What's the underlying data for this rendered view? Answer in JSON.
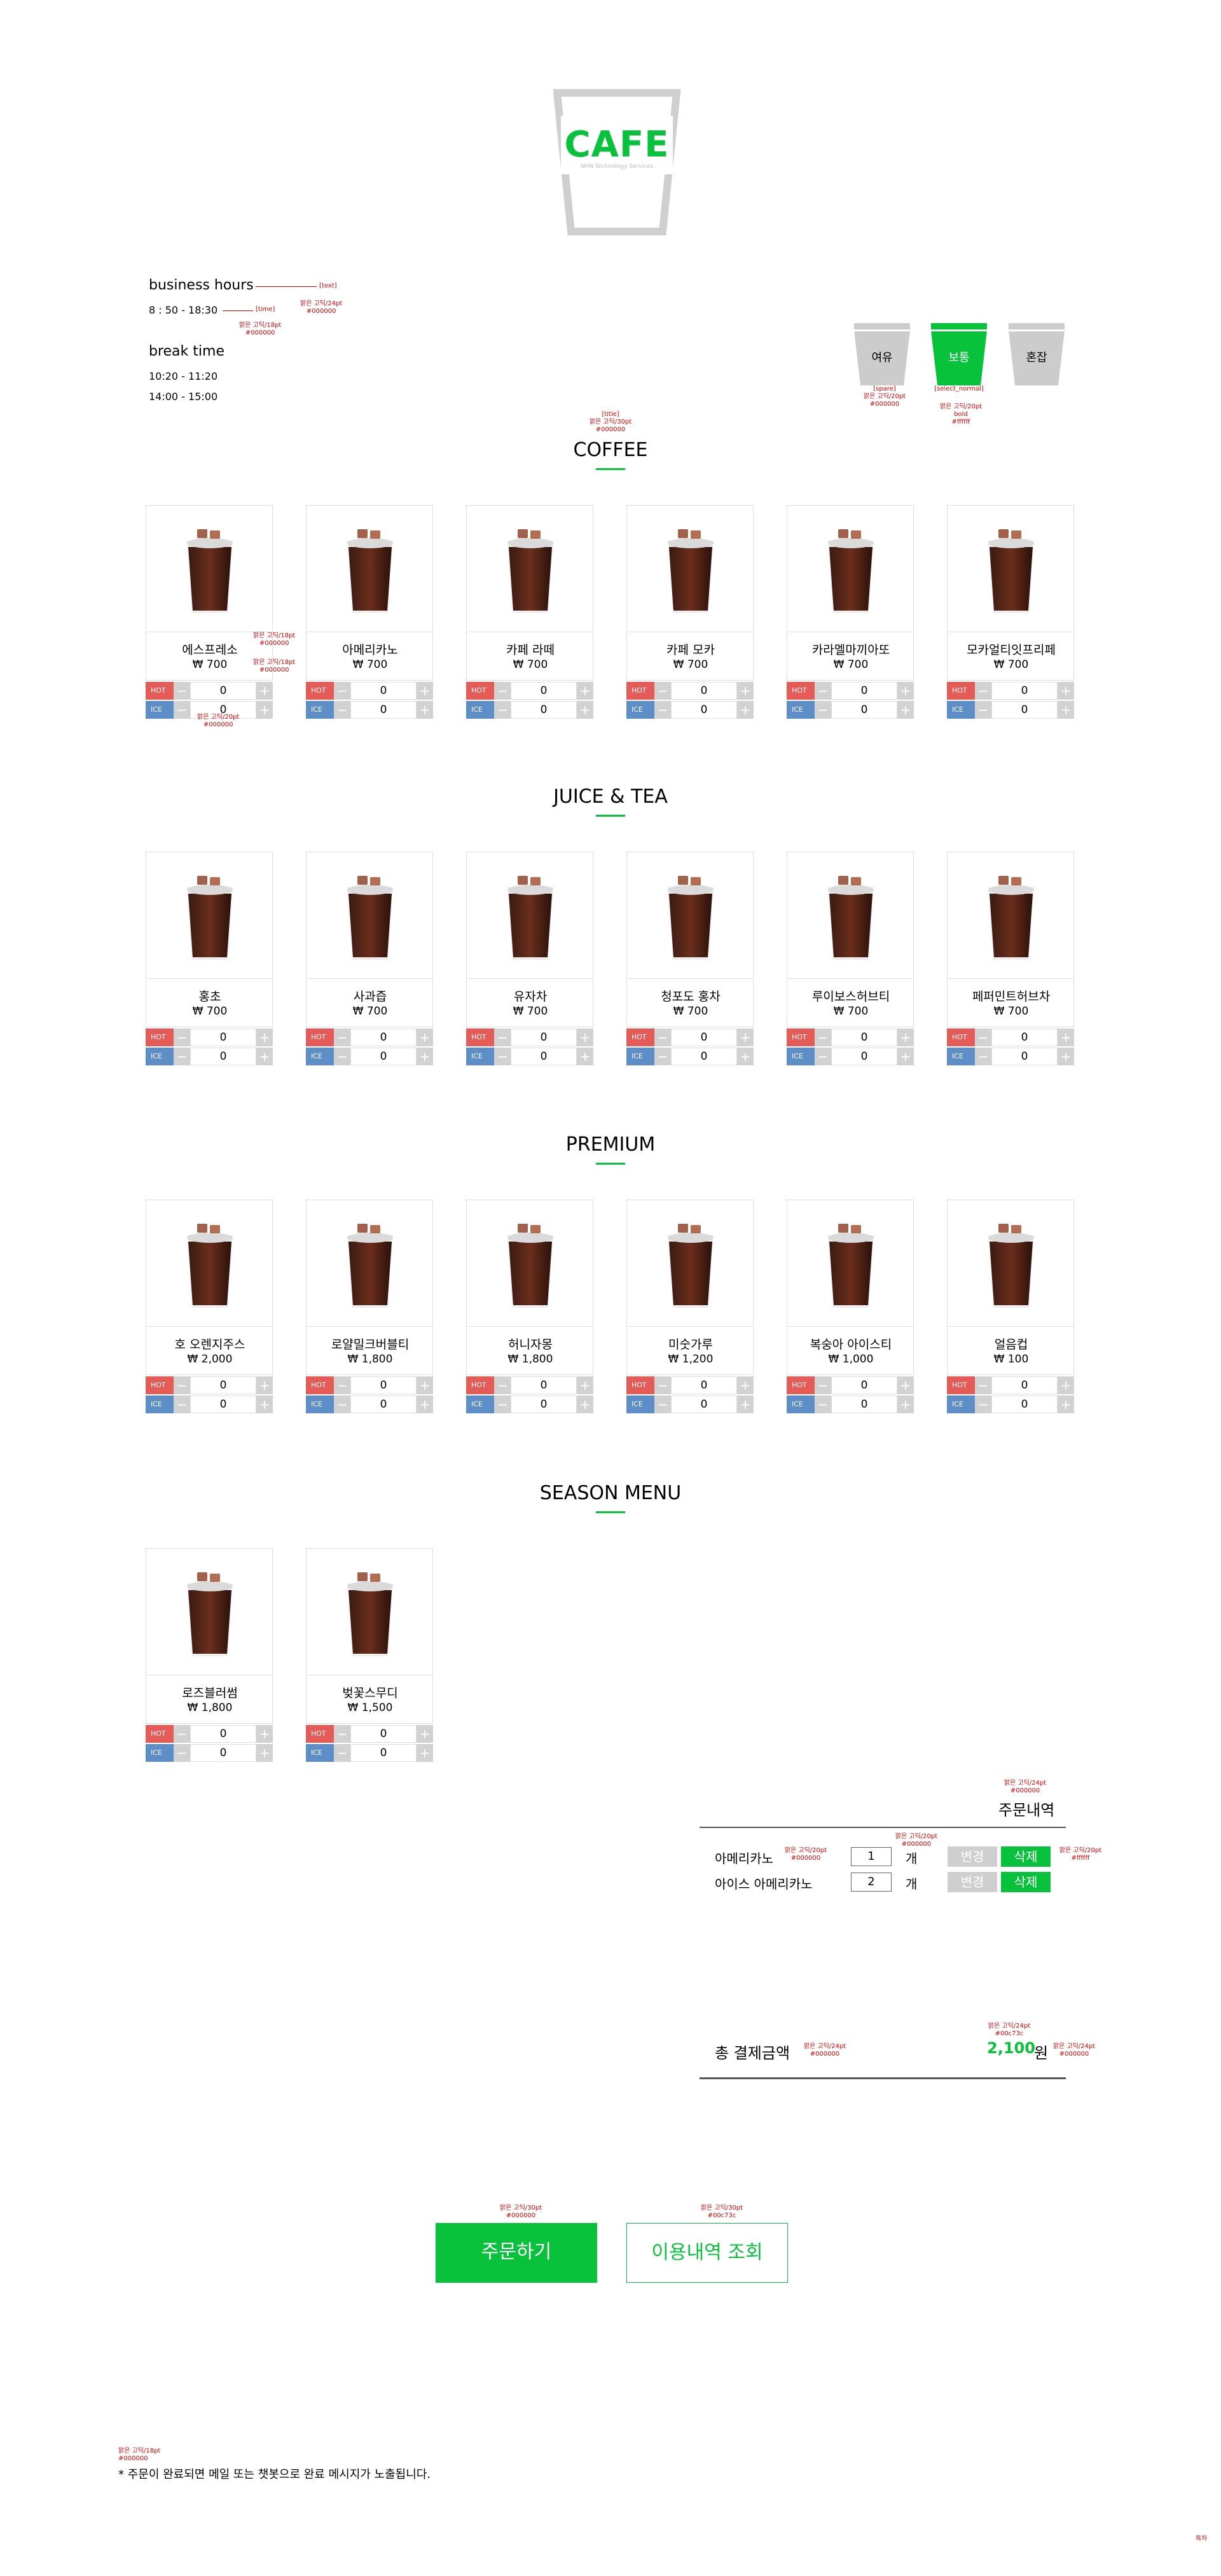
{
  "logo": {
    "title": "CAFE",
    "subtitle": "NHN Technology Services"
  },
  "hours": {
    "business_label": "business hours",
    "business_time": "8 : 50  -  18:30",
    "break_label": "break time",
    "break_times": [
      "10:20  -  11:20",
      "14:00  -  15:00"
    ]
  },
  "crowd": {
    "options": [
      {
        "label": "여유",
        "color": "#cccccc",
        "selected": false
      },
      {
        "label": "보통",
        "color": "#09c23c",
        "selected": true
      },
      {
        "label": "혼잡",
        "color": "#cccccc",
        "selected": false
      }
    ]
  },
  "sections": [
    {
      "title": "COFFEE",
      "items": [
        {
          "name": "에스프레소",
          "price": "₩ 700",
          "hot": "0",
          "ice": "0"
        },
        {
          "name": "아메리카노",
          "price": "₩ 700",
          "hot": "0",
          "ice": "0"
        },
        {
          "name": "카페 라떼",
          "price": "₩ 700",
          "hot": "0",
          "ice": "0"
        },
        {
          "name": "카페 모카",
          "price": "₩ 700",
          "hot": "0",
          "ice": "0"
        },
        {
          "name": "카라멜마끼아또",
          "price": "₩ 700",
          "hot": "0",
          "ice": "0"
        },
        {
          "name": "모카얼티잇프리페",
          "price": "₩ 700",
          "hot": "0",
          "ice": "0"
        }
      ]
    },
    {
      "title": "JUICE & TEA",
      "items": [
        {
          "name": "홍초",
          "price": "₩ 700",
          "hot": "0",
          "ice": "0"
        },
        {
          "name": "사과즙",
          "price": "₩ 700",
          "hot": "0",
          "ice": "0"
        },
        {
          "name": "유자차",
          "price": "₩ 700",
          "hot": "0",
          "ice": "0"
        },
        {
          "name": "청포도 홍차",
          "price": "₩ 700",
          "hot": "0",
          "ice": "0"
        },
        {
          "name": "루이보스허브티",
          "price": "₩ 700",
          "hot": "0",
          "ice": "0"
        },
        {
          "name": "페퍼민트허브차",
          "price": "₩ 700",
          "hot": "0",
          "ice": "0"
        }
      ]
    },
    {
      "title": "PREMIUM",
      "items": [
        {
          "name": "호 오렌지주스",
          "price": "₩ 2,000",
          "hot": "0",
          "ice": "0"
        },
        {
          "name": "로얄밀크버블티",
          "price": "₩ 1,800",
          "hot": "0",
          "ice": "0"
        },
        {
          "name": "허니자몽",
          "price": "₩ 1,800",
          "hot": "0",
          "ice": "0"
        },
        {
          "name": "미숫가루",
          "price": "₩ 1,200",
          "hot": "0",
          "ice": "0"
        },
        {
          "name": "복숭아 아이스티",
          "price": "₩ 1,000",
          "hot": "0",
          "ice": "0"
        },
        {
          "name": "얼음컵",
          "price": "₩ 100",
          "hot": "0",
          "ice": "0"
        }
      ]
    },
    {
      "title": "SEASON MENU",
      "items": [
        {
          "name": "로즈블러썸",
          "price": "₩ 1,800",
          "hot": "0",
          "ice": "0"
        },
        {
          "name": "벚꽃스무디",
          "price": "₩ 1,500",
          "hot": "0",
          "ice": "0"
        }
      ]
    }
  ],
  "labels": {
    "hot": "HOT",
    "ice": "ICE",
    "minus": "−",
    "plus": "+"
  },
  "order": {
    "title": "주문내역",
    "items": [
      {
        "name": "아메리카노",
        "qty": "1",
        "unit": "개",
        "change": "변경",
        "delete": "삭제"
      },
      {
        "name": "아이스 아메리카노",
        "qty": "2",
        "unit": "개",
        "change": "변경",
        "delete": "삭제"
      }
    ],
    "total_label": "총 결제금액",
    "total_value": "2,100",
    "total_unit": "원"
  },
  "buttons": {
    "order": "주문하기",
    "history": "이용내역 조회"
  },
  "footnote": "* 주문이 완료되면 메일 또는 챗봇으로 완료 메시지가 노출됩니다.",
  "annotations": {
    "text": "[text]",
    "time": "[time]",
    "font24": "맑은 고딕/24pt",
    "font18": "맑은 고딕/18pt",
    "font20": "맑은 고딕/20pt",
    "font30": "맑은 고딕/30pt",
    "color000": "#000000",
    "colorfff": "#ffffff",
    "color00c73c": "#00c73c",
    "spare": "[spare]",
    "select_normal": "[select_normal]",
    "bold": "bold",
    "title": "[title]",
    "corner": "목차"
  },
  "colors": {
    "accent": "#09c23c",
    "hot": "#e45b58",
    "ice": "#5e8ec8",
    "annotation": "#e00000"
  }
}
